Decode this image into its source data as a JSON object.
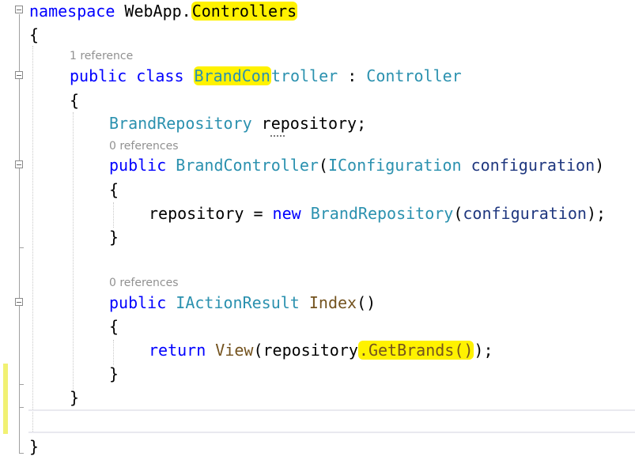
{
  "colors": {
    "keyword": "#0000ff",
    "type": "#2b91af",
    "method": "#74531f",
    "parameter": "#1f377f",
    "highlight": "#fff200",
    "codelens": "#919191",
    "change_bar": "#f1f173"
  },
  "code": {
    "line1": {
      "kw": "namespace",
      "ns_prefix": " WebApp.",
      "ns_highlight": "Controllers"
    },
    "line2": {
      "brace": "{"
    },
    "lens1": "1 reference",
    "line3": {
      "kw": "public class",
      "name_hl": "BrandCon",
      "name_rest": "troller",
      "colon": " : ",
      "base": "Controller"
    },
    "line4": {
      "brace": "{"
    },
    "line5": {
      "type": "BrandRepository",
      "field": " repository;"
    },
    "lens2": "0 references",
    "line6": {
      "kw": "public",
      "ctor": "BrandController",
      "open": "(",
      "ptype": "IConfiguration",
      "pname": " configuration",
      "close": ")"
    },
    "line7": {
      "brace": "{"
    },
    "line8": {
      "lhs": "repository = ",
      "kw": "new",
      "type": "BrandRepository",
      "open": "(",
      "arg": "configuration",
      "close": ");"
    },
    "line9": {
      "brace": "}"
    },
    "lens3": "0 references",
    "line10": {
      "kw": "public",
      "rtype": "IActionResult",
      "method": "Index",
      "parens": "()"
    },
    "line11": {
      "brace": "{"
    },
    "line12": {
      "kw": "return",
      "view": "View",
      "open": "(repository",
      "call_hl": ".GetBrands()",
      "close": ");"
    },
    "line13": {
      "brace": "}"
    },
    "line14": {
      "brace": "}"
    },
    "line16": {
      "brace": "}"
    }
  }
}
